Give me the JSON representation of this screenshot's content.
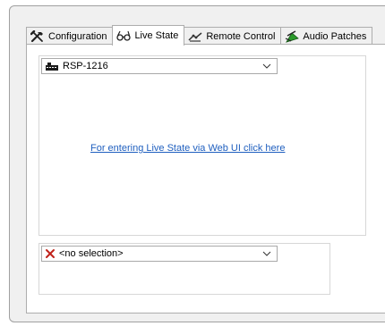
{
  "tabs": [
    {
      "label": "Configuration",
      "icon": "tools-icon"
    },
    {
      "label": "Live State",
      "icon": "glasses-icon"
    },
    {
      "label": "Remote Control",
      "icon": "remote-icon"
    },
    {
      "label": "Audio Patches",
      "icon": "patch-icon"
    }
  ],
  "active_tab": "Live State",
  "device_selector": {
    "value": "RSP-1216",
    "icon": "device-icon"
  },
  "web_ui_link": "For entering Live State via Web UI click here",
  "selection_selector": {
    "value": "<no selection>",
    "icon": "red-x-icon"
  },
  "colors": {
    "link": "#1f5fbf",
    "x_icon": "#c0221a",
    "patch_icon": "#2a9a2a"
  }
}
